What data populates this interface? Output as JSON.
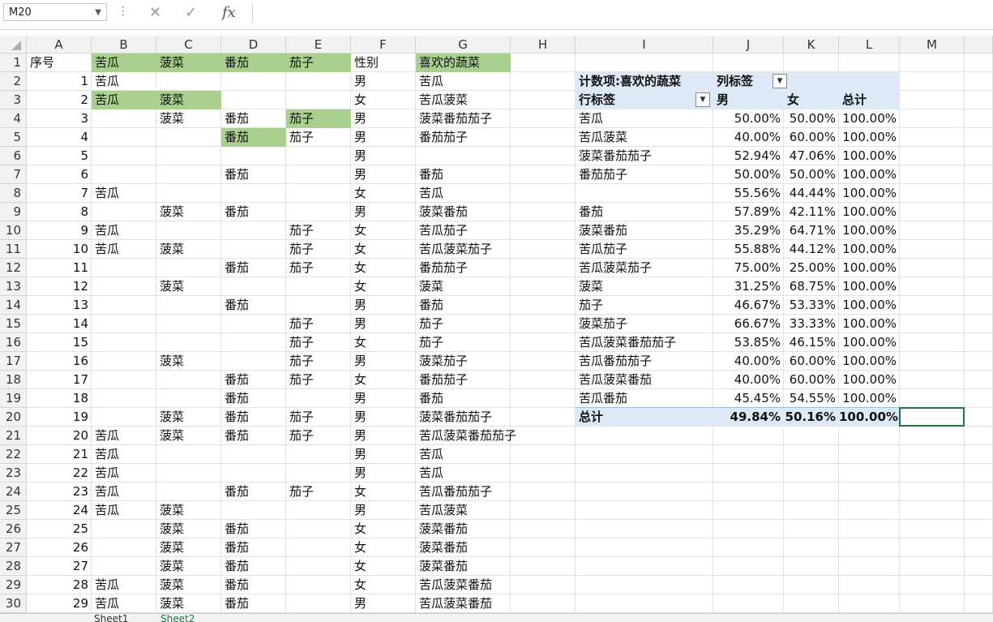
{
  "namebox": {
    "value": "M20"
  },
  "formula": {
    "cancel_icon": "x-icon",
    "confirm_icon": "check-icon",
    "fx_label": "fx",
    "value": ""
  },
  "columns": [
    "A",
    "B",
    "C",
    "D",
    "E",
    "F",
    "G",
    "H",
    "I",
    "J",
    "K",
    "L",
    "M"
  ],
  "rows": [
    [
      "序号",
      "苦瓜",
      "菠菜",
      "番茄",
      "茄子",
      "性别",
      "喜欢的蔬菜"
    ],
    [
      "1",
      "苦瓜",
      "",
      "",
      "",
      "男",
      "苦瓜"
    ],
    [
      "2",
      "苦瓜",
      "菠菜",
      "",
      "",
      "女",
      "苦瓜菠菜"
    ],
    [
      "3",
      "",
      "菠菜",
      "番茄",
      "茄子",
      "男",
      "菠菜番茄茄子"
    ],
    [
      "4",
      "",
      "",
      "番茄",
      "茄子",
      "男",
      "番茄茄子"
    ],
    [
      "5",
      "",
      "",
      "",
      "",
      "男",
      ""
    ],
    [
      "6",
      "",
      "",
      "番茄",
      "",
      "男",
      "番茄"
    ],
    [
      "7",
      "苦瓜",
      "",
      "",
      "",
      "女",
      "苦瓜"
    ],
    [
      "8",
      "",
      "菠菜",
      "番茄",
      "",
      "男",
      "菠菜番茄"
    ],
    [
      "9",
      "苦瓜",
      "",
      "",
      "茄子",
      "女",
      "苦瓜茄子"
    ],
    [
      "10",
      "苦瓜",
      "菠菜",
      "",
      "茄子",
      "女",
      "苦瓜菠菜茄子"
    ],
    [
      "11",
      "",
      "",
      "番茄",
      "茄子",
      "女",
      "番茄茄子"
    ],
    [
      "12",
      "",
      "菠菜",
      "",
      "",
      "女",
      "菠菜"
    ],
    [
      "13",
      "",
      "",
      "番茄",
      "",
      "男",
      "番茄"
    ],
    [
      "14",
      "",
      "",
      "",
      "茄子",
      "男",
      "茄子"
    ],
    [
      "15",
      "",
      "",
      "",
      "茄子",
      "女",
      "茄子"
    ],
    [
      "16",
      "",
      "菠菜",
      "",
      "茄子",
      "男",
      "菠菜茄子"
    ],
    [
      "17",
      "",
      "",
      "番茄",
      "茄子",
      "女",
      "番茄茄子"
    ],
    [
      "18",
      "",
      "",
      "番茄",
      "",
      "男",
      "番茄"
    ],
    [
      "19",
      "",
      "菠菜",
      "番茄",
      "茄子",
      "男",
      "菠菜番茄茄子"
    ],
    [
      "20",
      "苦瓜",
      "菠菜",
      "番茄",
      "茄子",
      "男",
      "苦瓜菠菜番茄茄子"
    ],
    [
      "21",
      "苦瓜",
      "",
      "",
      "",
      "男",
      "苦瓜"
    ],
    [
      "22",
      "苦瓜",
      "",
      "",
      "",
      "男",
      "苦瓜"
    ],
    [
      "23",
      "苦瓜",
      "",
      "番茄",
      "茄子",
      "女",
      "苦瓜番茄茄子"
    ],
    [
      "24",
      "苦瓜",
      "菠菜",
      "",
      "",
      "男",
      "苦瓜菠菜"
    ],
    [
      "25",
      "",
      "菠菜",
      "番茄",
      "",
      "女",
      "菠菜番茄"
    ],
    [
      "26",
      "",
      "菠菜",
      "番茄",
      "",
      "女",
      "菠菜番茄"
    ],
    [
      "27",
      "",
      "菠菜",
      "番茄",
      "",
      "女",
      "菠菜番茄"
    ],
    [
      "28",
      "苦瓜",
      "菠菜",
      "番茄",
      "",
      "女",
      "苦瓜菠菜番茄"
    ],
    [
      "29",
      "苦瓜",
      "菠菜",
      "番茄",
      "",
      "男",
      "苦瓜菠菜番茄"
    ]
  ],
  "pivot": {
    "title": "计数项:喜欢的蔬菜",
    "col_label": "列标签",
    "row_label": "行标签",
    "headers": [
      "男",
      "女",
      "总计"
    ],
    "rows": [
      [
        "苦瓜",
        "50.00%",
        "50.00%",
        "100.00%"
      ],
      [
        "苦瓜菠菜",
        "40.00%",
        "60.00%",
        "100.00%"
      ],
      [
        "菠菜番茄茄子",
        "52.94%",
        "47.06%",
        "100.00%"
      ],
      [
        "番茄茄子",
        "50.00%",
        "50.00%",
        "100.00%"
      ],
      [
        "",
        "55.56%",
        "44.44%",
        "100.00%"
      ],
      [
        "番茄",
        "57.89%",
        "42.11%",
        "100.00%"
      ],
      [
        "菠菜番茄",
        "35.29%",
        "64.71%",
        "100.00%"
      ],
      [
        "苦瓜茄子",
        "55.88%",
        "44.12%",
        "100.00%"
      ],
      [
        "苦瓜菠菜茄子",
        "75.00%",
        "25.00%",
        "100.00%"
      ],
      [
        "菠菜",
        "31.25%",
        "68.75%",
        "100.00%"
      ],
      [
        "茄子",
        "46.67%",
        "53.33%",
        "100.00%"
      ],
      [
        "菠菜茄子",
        "66.67%",
        "33.33%",
        "100.00%"
      ],
      [
        "苦瓜菠菜番茄茄子",
        "53.85%",
        "46.15%",
        "100.00%"
      ],
      [
        "苦瓜番茄茄子",
        "40.00%",
        "60.00%",
        "100.00%"
      ],
      [
        "苦瓜菠菜番茄",
        "40.00%",
        "60.00%",
        "100.00%"
      ],
      [
        "苦瓜番茄",
        "45.45%",
        "54.55%",
        "100.00%"
      ]
    ],
    "total": [
      "总计",
      "49.84%",
      "50.16%",
      "100.00%"
    ]
  },
  "sheet_tabs": [
    "Sheet1",
    "Sheet2"
  ]
}
